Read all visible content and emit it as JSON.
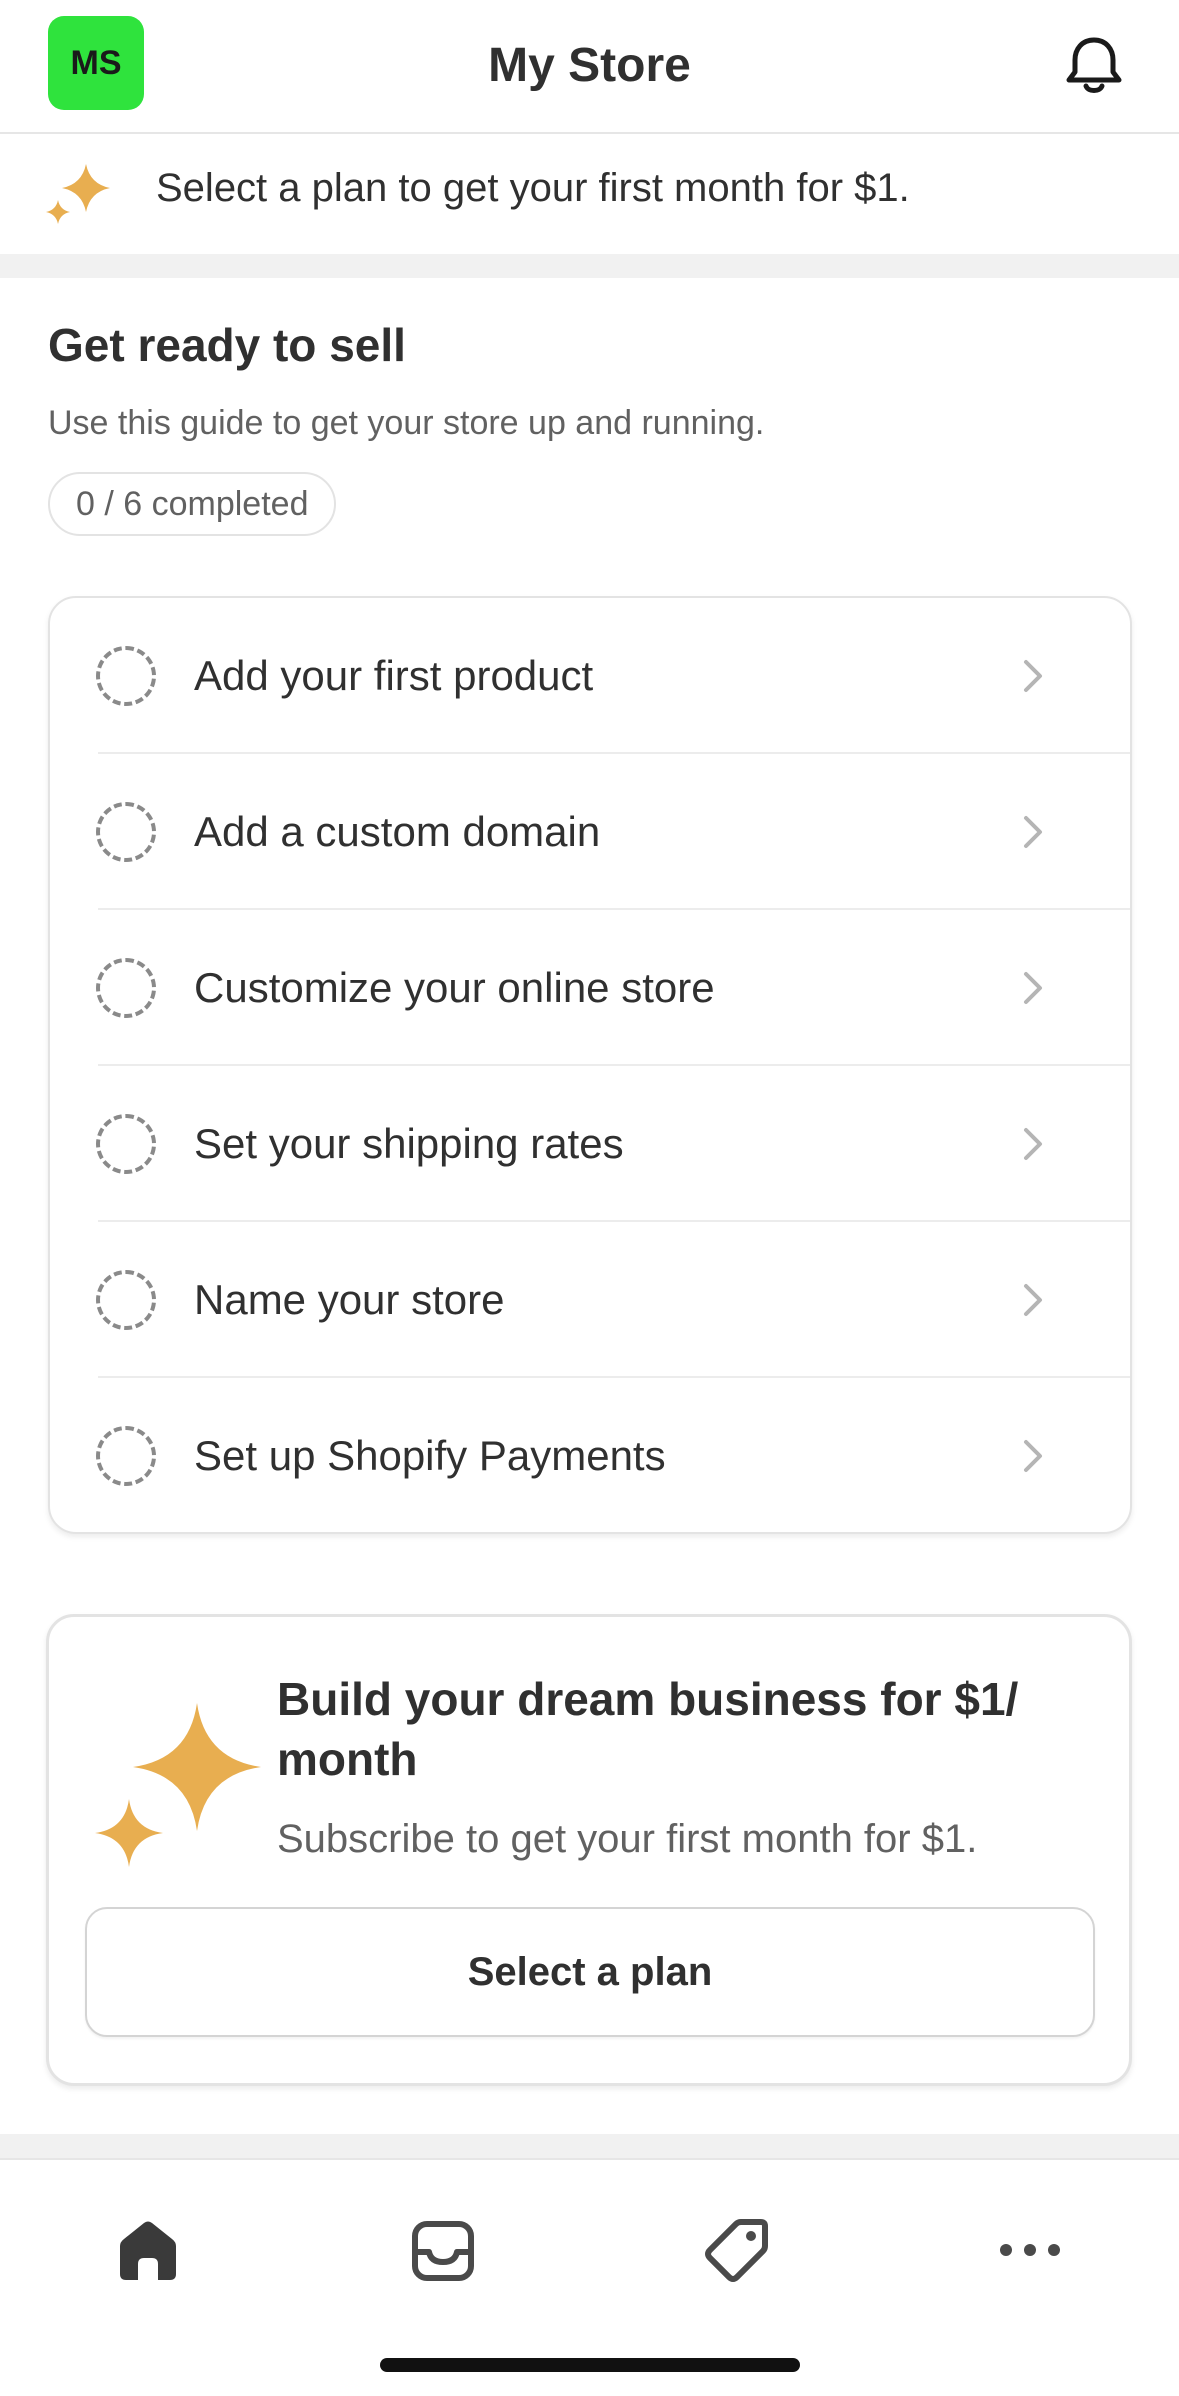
{
  "header": {
    "avatar_initials": "MS",
    "title": "My Store",
    "notification_icon": "bell-icon"
  },
  "promo": {
    "icon": "sparkle-icon",
    "text": "Select a plan to get your first month for $1."
  },
  "setup_guide": {
    "title": "Get ready to sell",
    "subtitle": "Use this guide to get your store up and running.",
    "progress": "0 / 6 completed",
    "tasks": [
      {
        "label": "Add your first product"
      },
      {
        "label": "Add a custom domain"
      },
      {
        "label": "Customize your online store"
      },
      {
        "label": "Set your shipping rates"
      },
      {
        "label": "Name your store"
      },
      {
        "label": "Set up Shopify Payments"
      }
    ]
  },
  "plan_card": {
    "title": "Build your dream business for $1/ month",
    "subtitle": "Subscribe to get your first month for $1.",
    "button_label": "Select a plan",
    "accent_color": "#E8AE50"
  },
  "tab_bar": {
    "tabs": [
      {
        "icon": "home-icon",
        "active": true
      },
      {
        "icon": "orders-inbox-icon",
        "active": false
      },
      {
        "icon": "products-tag-icon",
        "active": false
      },
      {
        "icon": "more-icon",
        "active": false
      }
    ]
  },
  "colors": {
    "avatar": "#2FE33D",
    "text_primary": "#303030",
    "text_secondary": "#616161",
    "sparkle": "#E8AE50"
  }
}
